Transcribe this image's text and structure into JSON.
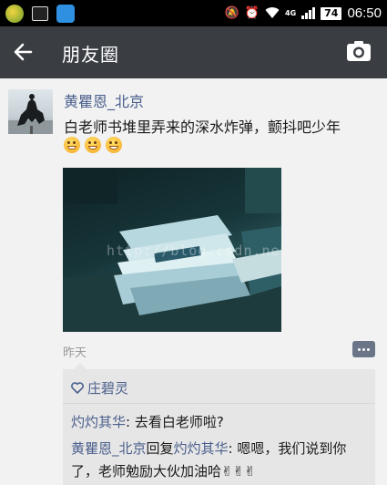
{
  "status_bar": {
    "network": "4G",
    "battery": "74",
    "time": "06:50",
    "icons": [
      "app-icon",
      "screenshot-icon",
      "app-icon",
      "mute-icon",
      "alarm-icon",
      "wifi-icon",
      "signal-icon",
      "battery-icon"
    ]
  },
  "header": {
    "title": "朋友圈",
    "icons": [
      "back-arrow-icon",
      "camera-icon"
    ]
  },
  "post": {
    "author": "黄瞿恩_北京",
    "text": "白老师书堆里弄来的深水炸弹，颤抖吧少年",
    "emoji_count": 3,
    "image_watermark": "http://blog.csdn.net/",
    "time": "昨天",
    "likes": {
      "icon": "heart-icon",
      "names": "庄碧灵"
    },
    "comments": [
      {
        "author": "灼灼其华",
        "separator": ": ",
        "text": "去看白老师啦?"
      },
      {
        "author": "黄瞿恩_北京",
        "reply_word": "回复",
        "reply_to": "灼灼其华",
        "separator": ": ",
        "text": "嗯嗯，我们说到你了，老师勉励大伙加油哈",
        "trailing_emoji": "✌✌✌"
      }
    ]
  },
  "colors": {
    "status_bar_bg": "#000000",
    "header_bg": "#3a3e43",
    "name_link": "#4a5f8c",
    "comment_bg": "#e6e6e6",
    "page_bg": "#f2f2f2"
  }
}
